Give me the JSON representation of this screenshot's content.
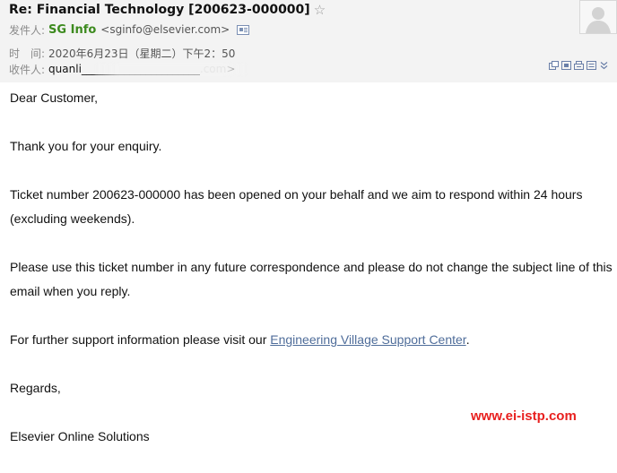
{
  "email": {
    "subject": "Re: Financial Technology [200623-000000]",
    "from_label": "发件人:",
    "from_name": "SG Info",
    "from_email": "<sginfo@elsevier.com>",
    "time_label": "时　间:",
    "time_value": "2020年6月23日（星期二）下午2：50",
    "to_label": "收件人:",
    "to_value": "quanli______________________.com>"
  },
  "body": {
    "greeting": "Dear Customer,",
    "thanks": "Thank you for your enquiry.",
    "ticket_para": "Ticket number 200623-000000 has been opened on your behalf and we aim to respond within 24 hours (excluding weekends).",
    "usage_para": "Please use this ticket number in any future correspondence and please do not change the subject line of this email when you reply.",
    "support_prefix": "For further support information please visit our ",
    "support_link": "Engineering Village Support Center",
    "support_suffix": ".",
    "regards": "Regards,",
    "signature": "Elsevier Online Solutions"
  },
  "watermark": "www.ei-istp.com",
  "icons": {
    "star": "star-icon",
    "contact_card": "contact-card-icon",
    "avatar": "avatar-placeholder-icon",
    "toolbar": [
      "new-window-icon",
      "copy-icon",
      "print-icon",
      "menu-icon",
      "more-chevron-icon"
    ]
  },
  "colors": {
    "header_bg": "#f3f3f3",
    "sender_name": "#3c8a1e",
    "link": "#4f6d9a",
    "watermark": "#e8201f"
  }
}
